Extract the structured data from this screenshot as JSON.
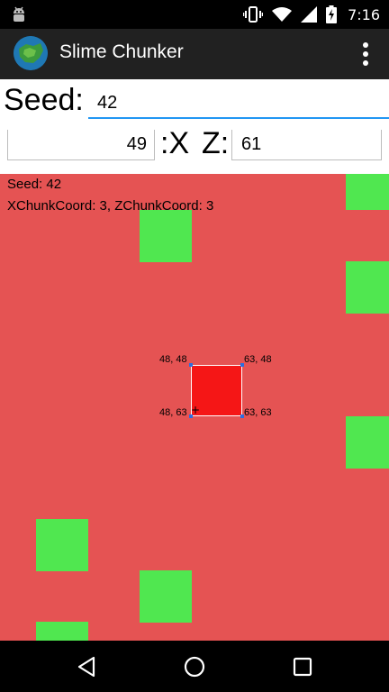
{
  "status_bar": {
    "time": "7:16"
  },
  "app_bar": {
    "title": "Slime Chunker"
  },
  "form": {
    "seed_label": "Seed:",
    "seed_value": "42",
    "x_value": "49",
    "x_label": ":X",
    "z_label": "Z:",
    "z_value": "61"
  },
  "map": {
    "info_seed": "Seed: 42",
    "info_chunk": "XChunkCoord: 3, ZChunkCoord: 3",
    "corner_top_left": "48, 48",
    "corner_top_right": "63, 48",
    "corner_bottom_left": "48, 63",
    "corner_bottom_right": "63, 63",
    "crosshair": "+"
  },
  "colors": {
    "map_background": "#e55353",
    "slime_chunk": "#50e750",
    "selected_chunk": "#f51616",
    "app_bar": "#212121",
    "accent": "#2196f3"
  }
}
